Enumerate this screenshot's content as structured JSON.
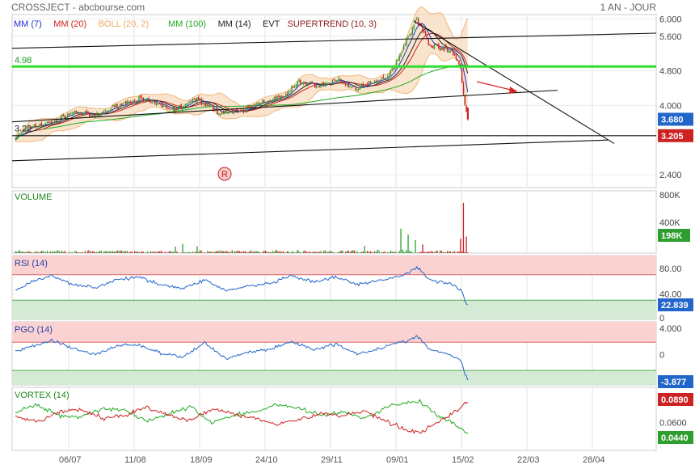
{
  "header": {
    "title": "CROSSJECT - abcbourse.com",
    "period": "1 AN - JOUR"
  },
  "colors": {
    "up": "#2e9e2e",
    "down": "#cc2222",
    "mm7": "#2233cc",
    "mm20": "#cc2222",
    "boll": "#f0a860",
    "mm100": "#22aa22",
    "mm14": "#222222",
    "rsi": "#2266cc",
    "vortex_plus": "#22aa22",
    "vortex_minus": "#cc2222",
    "level": "#33dd33"
  },
  "chart_data": [
    {
      "type": "candlestick",
      "panel": "price",
      "legend": [
        "MM (7)",
        "MM (20)",
        "BOLL (20, 2)",
        "MM (100)",
        "MM (14)",
        "EVT",
        "SUPERTREND (10, 3)"
      ],
      "x_tick_labels": [
        "06/07",
        "11/08",
        "18/09",
        "24/10",
        "29/11",
        "09/01",
        "15/02",
        "22/03",
        "28/04"
      ],
      "y_tick_labels": [
        "6.000",
        "5.600",
        "4.800",
        "4.000",
        "2.400"
      ],
      "level_label": "4.98",
      "low_label": "3.22",
      "price_badge": "3.680",
      "support_badge": "3.205",
      "event_marker": "R",
      "ylim": [
        2.1,
        6.1
      ],
      "close_anchors": [
        [
          0,
          3.25
        ],
        [
          10,
          3.5
        ],
        [
          25,
          3.6
        ],
        [
          40,
          3.85
        ],
        [
          55,
          3.75
        ],
        [
          70,
          4.0
        ],
        [
          85,
          4.15
        ],
        [
          95,
          4.05
        ],
        [
          110,
          3.9
        ],
        [
          125,
          4.15
        ],
        [
          140,
          3.85
        ],
        [
          155,
          3.85
        ],
        [
          170,
          4.1
        ],
        [
          185,
          4.2
        ],
        [
          195,
          4.55
        ],
        [
          210,
          4.45
        ],
        [
          222,
          4.6
        ],
        [
          232,
          4.4
        ],
        [
          245,
          4.5
        ],
        [
          255,
          4.65
        ],
        [
          262,
          5.0
        ],
        [
          270,
          5.6
        ],
        [
          276,
          6.0
        ],
        [
          285,
          5.4
        ],
        [
          292,
          5.35
        ],
        [
          302,
          5.2
        ],
        [
          306,
          4.85
        ],
        [
          309,
          4.0
        ],
        [
          311,
          3.68
        ]
      ]
    },
    {
      "type": "bar",
      "panel": "volume",
      "title": "VOLUME",
      "y_tick_labels": [
        "800K",
        "400K"
      ],
      "last_label": "198K",
      "ylim": [
        0,
        800
      ],
      "spikes": [
        [
          110,
          90
        ],
        [
          115,
          130
        ],
        [
          125,
          95
        ],
        [
          240,
          100
        ],
        [
          265,
          340
        ],
        [
          270,
          260
        ],
        [
          275,
          180
        ],
        [
          280,
          120
        ],
        [
          306,
          200
        ],
        [
          308,
          700
        ],
        [
          310,
          230
        ]
      ]
    },
    {
      "type": "line",
      "panel": "rsi",
      "title": "RSI (14)",
      "y_tick_labels": [
        "80.00",
        "40.00",
        "0"
      ],
      "last_label": "22.839",
      "ylim": [
        0,
        100
      ],
      "bands": [
        70,
        30
      ],
      "anchors": [
        [
          0,
          45
        ],
        [
          10,
          58
        ],
        [
          25,
          68
        ],
        [
          40,
          55
        ],
        [
          55,
          50
        ],
        [
          70,
          62
        ],
        [
          85,
          66
        ],
        [
          100,
          55
        ],
        [
          115,
          48
        ],
        [
          130,
          62
        ],
        [
          145,
          45
        ],
        [
          160,
          52
        ],
        [
          175,
          56
        ],
        [
          190,
          68
        ],
        [
          205,
          58
        ],
        [
          220,
          66
        ],
        [
          235,
          55
        ],
        [
          245,
          58
        ],
        [
          258,
          65
        ],
        [
          268,
          70
        ],
        [
          276,
          82
        ],
        [
          285,
          62
        ],
        [
          295,
          58
        ],
        [
          303,
          52
        ],
        [
          307,
          45
        ],
        [
          309,
          30
        ],
        [
          311,
          22.8
        ]
      ]
    },
    {
      "type": "line",
      "panel": "pgo",
      "title": "PGO (14)",
      "y_tick_labels": [
        "4.000",
        "0"
      ],
      "last_label": "-3.877",
      "ylim": [
        -4.6,
        5.0
      ],
      "bands": [
        1.9,
        -2.4
      ],
      "anchors": [
        [
          0,
          0.4
        ],
        [
          10,
          1.2
        ],
        [
          25,
          2.2
        ],
        [
          40,
          0.9
        ],
        [
          55,
          0.0
        ],
        [
          70,
          1.4
        ],
        [
          85,
          1.5
        ],
        [
          100,
          0.2
        ],
        [
          115,
          -0.4
        ],
        [
          130,
          1.8
        ],
        [
          145,
          -0.6
        ],
        [
          160,
          0.4
        ],
        [
          175,
          0.8
        ],
        [
          190,
          2.0
        ],
        [
          205,
          0.8
        ],
        [
          220,
          1.6
        ],
        [
          235,
          0.2
        ],
        [
          245,
          0.6
        ],
        [
          258,
          1.5
        ],
        [
          268,
          2.0
        ],
        [
          276,
          2.8
        ],
        [
          285,
          0.8
        ],
        [
          295,
          0.2
        ],
        [
          303,
          -0.4
        ],
        [
          307,
          -1.2
        ],
        [
          309,
          -3.0
        ],
        [
          311,
          -3.877
        ]
      ]
    },
    {
      "type": "line",
      "panel": "vortex",
      "title": "VORTEX (14)",
      "y_tick_labels": [
        "0.0600"
      ],
      "labels": [
        "0.0890",
        "0.0440"
      ],
      "ylim": [
        0.02,
        0.11
      ],
      "series": [
        {
          "key": "plus",
          "anchors": [
            [
              0,
              0.075
            ],
            [
              15,
              0.085
            ],
            [
              30,
              0.07
            ],
            [
              45,
              0.068
            ],
            [
              60,
              0.08
            ],
            [
              75,
              0.078
            ],
            [
              90,
              0.062
            ],
            [
              105,
              0.072
            ],
            [
              120,
              0.082
            ],
            [
              135,
              0.06
            ],
            [
              150,
              0.07
            ],
            [
              165,
              0.075
            ],
            [
              180,
              0.086
            ],
            [
              195,
              0.08
            ],
            [
              210,
              0.07
            ],
            [
              225,
              0.075
            ],
            [
              240,
              0.065
            ],
            [
              255,
              0.082
            ],
            [
              268,
              0.088
            ],
            [
              278,
              0.09
            ],
            [
              290,
              0.07
            ],
            [
              300,
              0.06
            ],
            [
              306,
              0.05
            ],
            [
              311,
              0.044
            ]
          ]
        },
        {
          "key": "minus",
          "anchors": [
            [
              0,
              0.068
            ],
            [
              15,
              0.06
            ],
            [
              30,
              0.075
            ],
            [
              45,
              0.078
            ],
            [
              60,
              0.066
            ],
            [
              75,
              0.07
            ],
            [
              90,
              0.082
            ],
            [
              105,
              0.07
            ],
            [
              120,
              0.062
            ],
            [
              135,
              0.08
            ],
            [
              150,
              0.072
            ],
            [
              165,
              0.066
            ],
            [
              180,
              0.058
            ],
            [
              195,
              0.064
            ],
            [
              210,
              0.072
            ],
            [
              225,
              0.07
            ],
            [
              240,
              0.076
            ],
            [
              255,
              0.062
            ],
            [
              268,
              0.05
            ],
            [
              278,
              0.045
            ],
            [
              290,
              0.06
            ],
            [
              300,
              0.072
            ],
            [
              306,
              0.08
            ],
            [
              311,
              0.089
            ]
          ]
        }
      ]
    }
  ]
}
